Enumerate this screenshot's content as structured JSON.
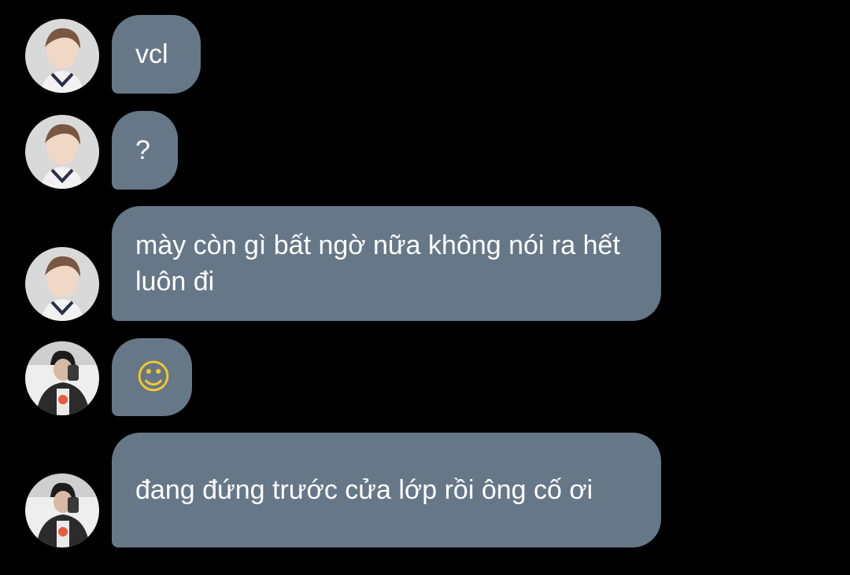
{
  "messages": [
    {
      "sender": "avatar-a",
      "text": "vcl"
    },
    {
      "sender": "avatar-a",
      "text": "?"
    },
    {
      "sender": "avatar-a",
      "text": "mày còn gì bất ngờ nữa không nói ra hết luôn đi"
    },
    {
      "sender": "avatar-b",
      "text": "",
      "emoji": "melting-face-emoji"
    },
    {
      "sender": "avatar-b",
      "text": "đang đứng trước cửa lớp rồi ông cố ơi"
    }
  ],
  "colors": {
    "background": "#000000",
    "bubble": "#667788",
    "text": "#ffffff"
  }
}
